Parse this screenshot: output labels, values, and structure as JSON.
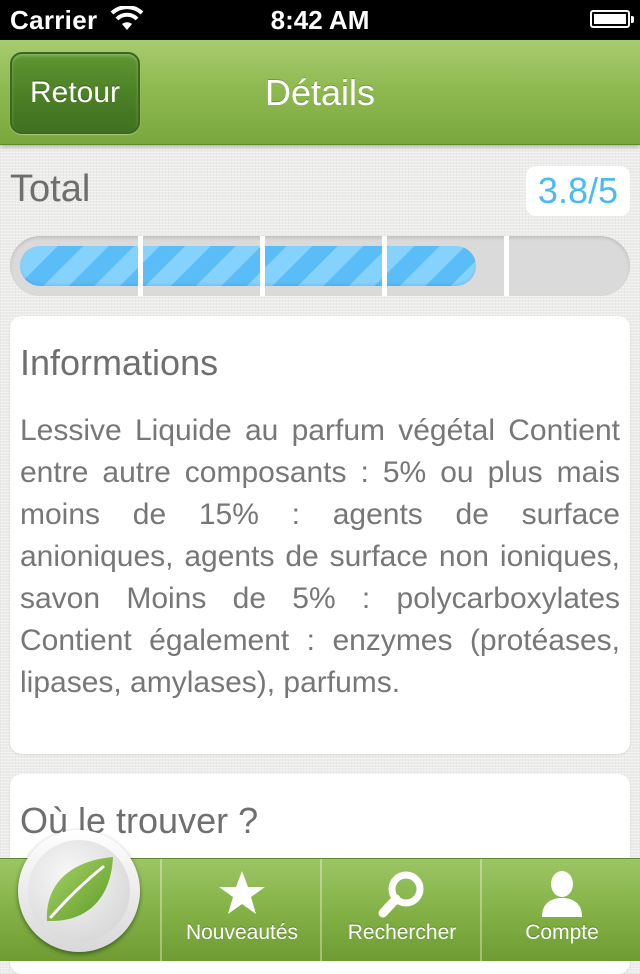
{
  "status_bar": {
    "carrier": "Carrier",
    "time": "8:42 AM"
  },
  "nav": {
    "back_label": "Retour",
    "title": "Détails"
  },
  "rating": {
    "label": "Total",
    "value_text": "3.8/5",
    "value": 3.8,
    "max": 5
  },
  "info": {
    "title": "Informations",
    "body": "Lessive Liquide au parfum végétal Contient entre autre composants : 5% ou plus mais moins de 15% : agents de surface anioniques, agents de surface non ioniques, savon Moins de 5% : polycarboxylates Contient également : enzymes (protéases, lipases, amylases), parfums."
  },
  "where": {
    "title": "Où le trouver ?"
  },
  "tabs": [
    {
      "label": "Nouveautés",
      "icon": "star-icon"
    },
    {
      "label": "Rechercher",
      "icon": "magnifier-icon"
    },
    {
      "label": "Compte",
      "icon": "person-icon"
    }
  ],
  "home_tab": {
    "icon": "leaf-icon"
  },
  "colors": {
    "accent": "#8fba52",
    "rating_fill": "#62c2fb",
    "rating_text": "#4db9f2"
  }
}
